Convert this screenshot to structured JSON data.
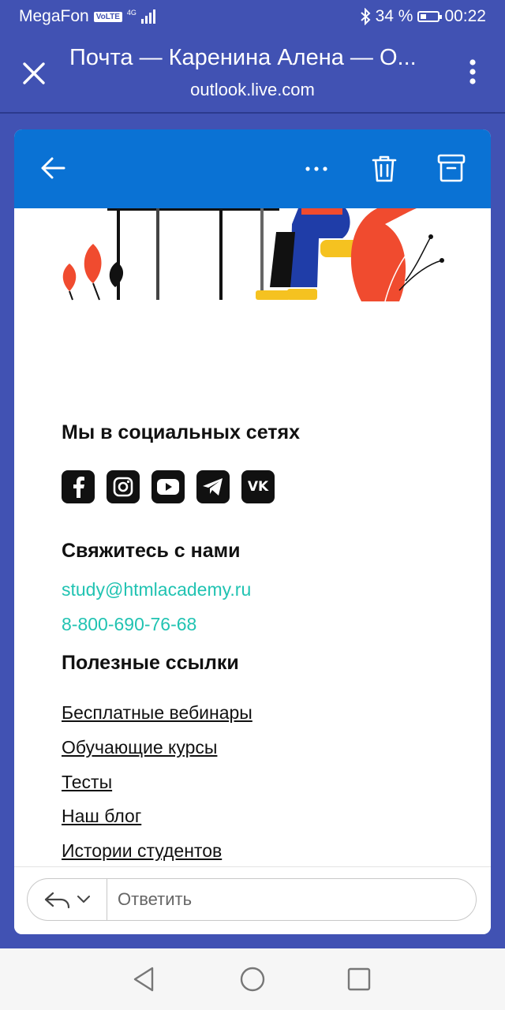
{
  "status_bar": {
    "carrier": "MegaFon",
    "volte": "VoLTE",
    "network": "4G",
    "battery_percent": "34 %",
    "battery_level": 0.34,
    "time": "00:22"
  },
  "browser": {
    "title": "Почта — Каренина Алена — О...",
    "url": "outlook.live.com"
  },
  "email": {
    "social_heading": "Мы в социальных сетях",
    "social_icons": [
      "facebook-icon",
      "instagram-icon",
      "youtube-icon",
      "telegram-icon",
      "vk-icon"
    ],
    "social_labels": {
      "vk": "VK"
    },
    "contact_heading": "Свяжитесь с нами",
    "email": "study@htmlacademy.ru",
    "phone": "8-800-690-76-68",
    "links_heading": "Полезные ссылки",
    "links": [
      "Бесплатные вебинары",
      "Обучающие курсы",
      "Тесты",
      "Наш блог",
      "Истории студентов"
    ]
  },
  "reply": {
    "placeholder": "Ответить"
  },
  "colors": {
    "chrome": "#4152b3",
    "toolbar": "#0a72d4",
    "link": "#21c3b2"
  }
}
